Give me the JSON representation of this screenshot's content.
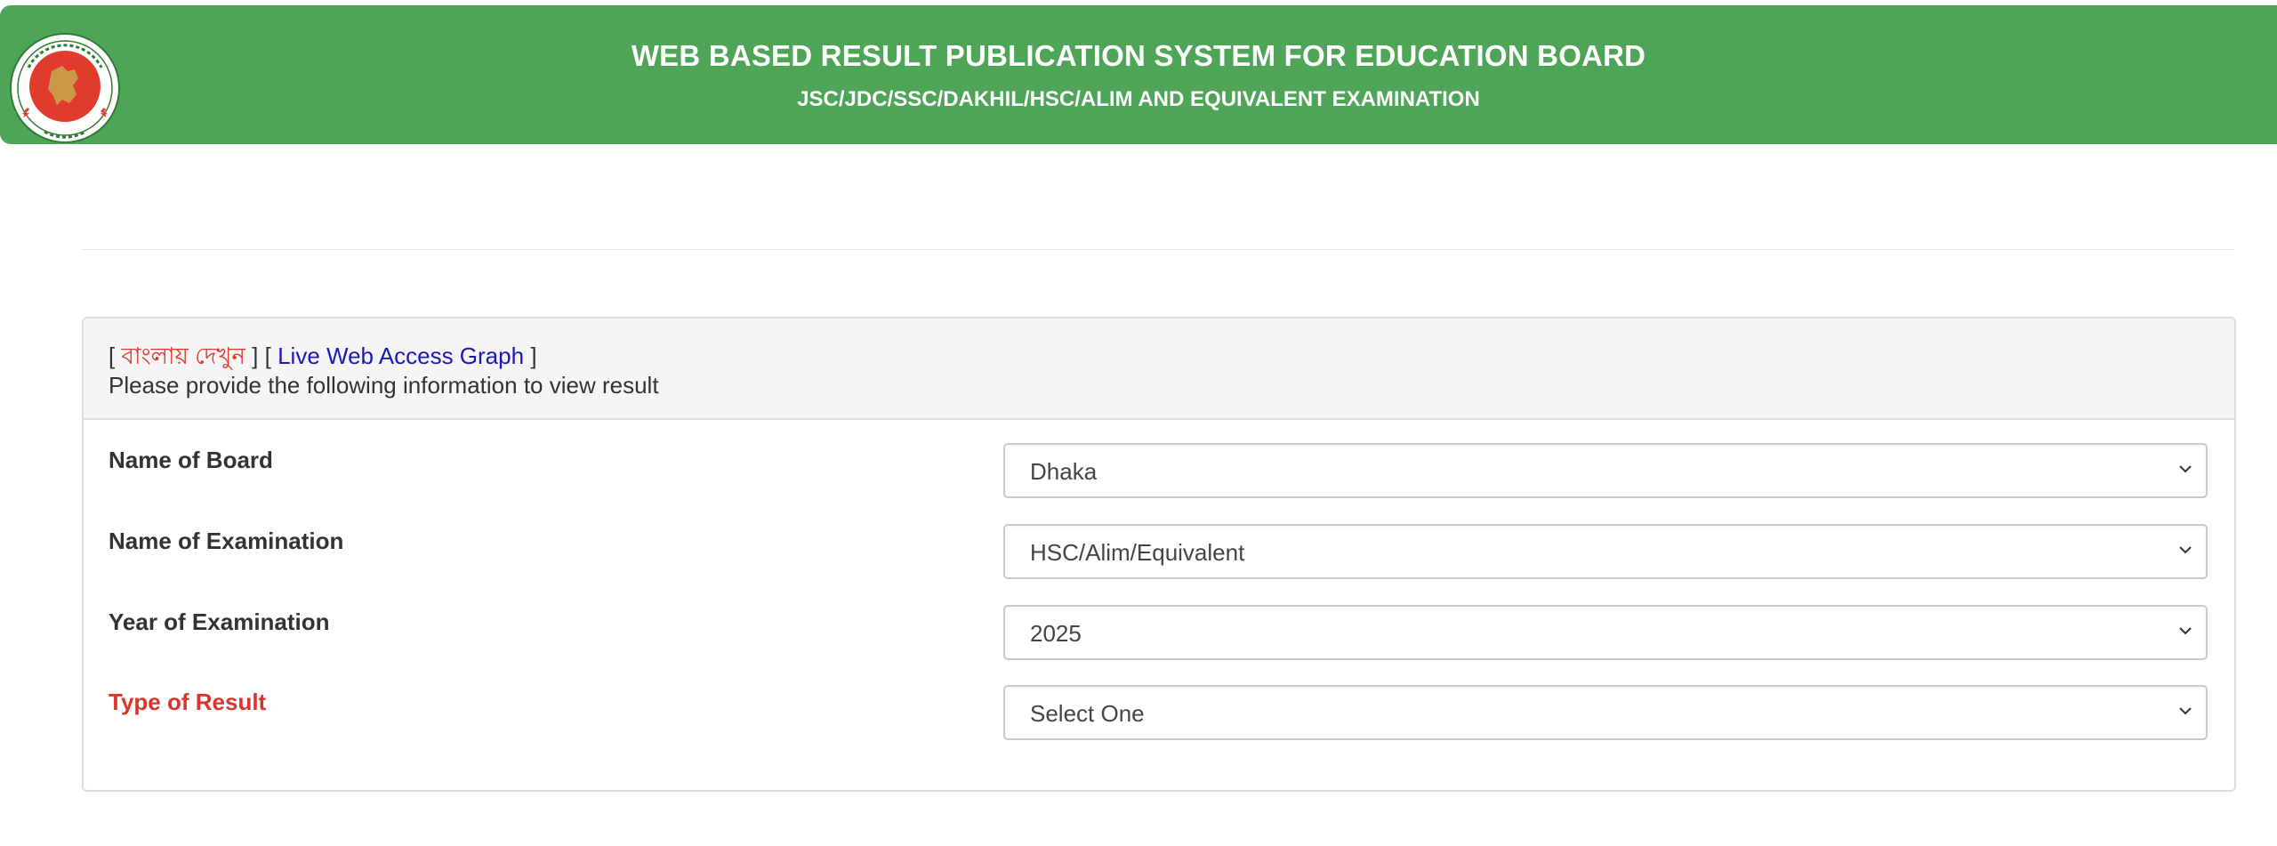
{
  "header": {
    "title": "WEB BASED RESULT PUBLICATION SYSTEM FOR EDUCATION BOARD",
    "subtitle": "JSC/JDC/SSC/DAKHIL/HSC/ALIM AND EQUIVALENT EXAMINATION",
    "logo_icon": "government-seal-icon",
    "bg_color": "#4ea457"
  },
  "panel": {
    "bracket_open_1": "[",
    "bangla_link": "বাংলায় দেখুন",
    "bracket_mid": "] [",
    "graph_link": "Live Web Access Graph",
    "bracket_close": "]",
    "instructions": "Please provide the following information to view result"
  },
  "form": {
    "board": {
      "label": "Name of Board",
      "value": "Dhaka"
    },
    "exam": {
      "label": "Name of Examination",
      "value": "HSC/Alim/Equivalent"
    },
    "year": {
      "label": "Year of Examination",
      "value": "2025"
    },
    "result_type": {
      "label": "Type of Result",
      "value": "Select One"
    }
  },
  "colors": {
    "required_label": "#d9362b",
    "bangla_link": "#e0362c",
    "graph_link": "#1a1ab8"
  }
}
